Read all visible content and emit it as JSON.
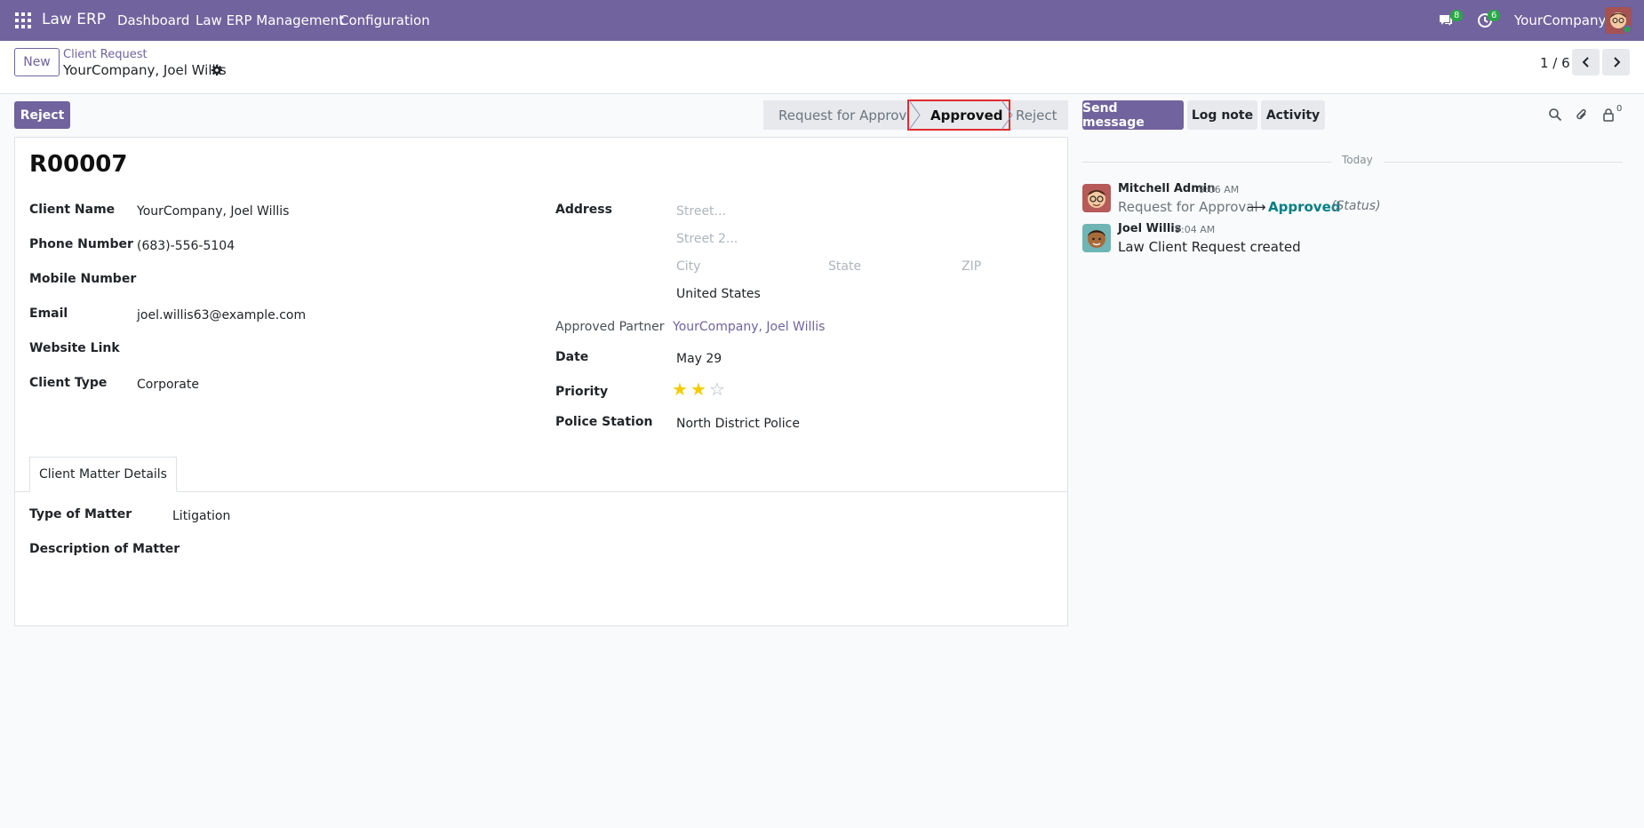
{
  "nav": {
    "brand": "Law ERP",
    "menu": [
      "Dashboard",
      "Law ERP Management",
      "Configuration"
    ],
    "messages_count": "8",
    "activities_count": "6",
    "company": "YourCompany"
  },
  "control_panel": {
    "new_label": "New",
    "breadcrumb_parent": "Client Request",
    "record_title": "YourCompany, Joel Willis",
    "pager": "1 / 6"
  },
  "statusbar": {
    "reject_button": "Reject",
    "stages": [
      "Request for Approval",
      "Approved",
      "Reject"
    ],
    "current_stage": "Approved"
  },
  "form": {
    "reference": "R00007",
    "left_fields": [
      {
        "label": "Client Name",
        "value": "YourCompany, Joel Willis"
      },
      {
        "label": "Phone Number",
        "value": "(683)-556-5104"
      },
      {
        "label": "Mobile Number",
        "value": ""
      },
      {
        "label": "Email",
        "value": "joel.willis63@example.com"
      },
      {
        "label": "Website Link",
        "value": ""
      },
      {
        "label": "Client Type",
        "value": "Corporate"
      }
    ],
    "address": {
      "label": "Address",
      "street_placeholder": "Street...",
      "street2_placeholder": "Street 2...",
      "city_placeholder": "City",
      "state_placeholder": "State",
      "zip_placeholder": "ZIP",
      "country": "United States"
    },
    "approved_partner": {
      "label": "Approved Partner",
      "value": "YourCompany, Joel Willis"
    },
    "date": {
      "label": "Date",
      "value": "May 29"
    },
    "priority": {
      "label": "Priority",
      "stars_filled": 2,
      "stars_total": 3
    },
    "police_station": {
      "label": "Police Station",
      "value": "North District Police"
    },
    "tab_label": "Client Matter Details",
    "matter": {
      "type_label": "Type of Matter",
      "type_value": "Litigation",
      "description_label": "Description of Matter"
    }
  },
  "chatter": {
    "send_message": "Send message",
    "log_note": "Log note",
    "activity": "Activity",
    "followers_count": "0",
    "today": "Today",
    "messages": [
      {
        "author": "Mitchell Admin",
        "time": "9:06 AM",
        "from": "Request for Approval",
        "arrow": "⟶",
        "to": "Approved",
        "field": "(Status)"
      },
      {
        "author": "Joel Willis",
        "time": "9:04 AM",
        "text": "Law Client Request created"
      }
    ]
  },
  "colors": {
    "primary": "#71639e",
    "highlight_border": "#e02b2b",
    "link_teal": "#017e84",
    "star": "#f3cc00"
  }
}
